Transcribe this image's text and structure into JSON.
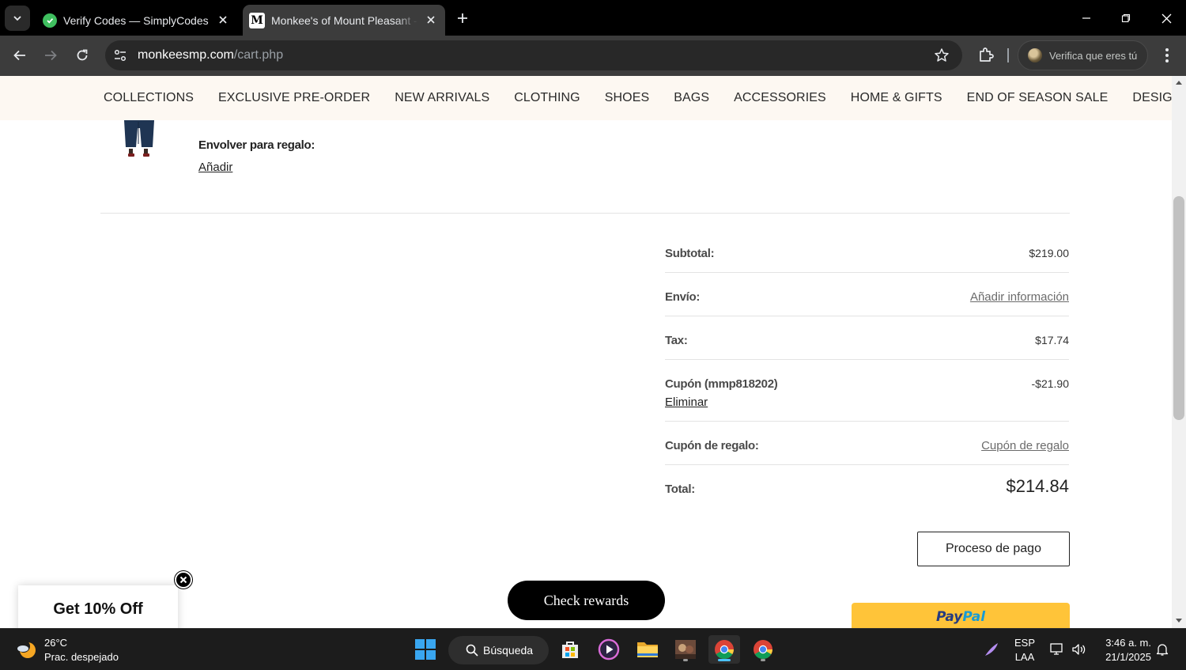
{
  "browser": {
    "tabs": [
      {
        "title": "Verify Codes — SimplyCodes",
        "active": false
      },
      {
        "title": "Monkee's of Mount Pleasant - S",
        "active": true
      }
    ],
    "url_host": "monkeesmp.com",
    "url_path": "/cart.php",
    "profile_label": "Verifica que eres tú"
  },
  "site": {
    "nav": [
      "COLLECTIONS",
      "EXCLUSIVE PRE-ORDER",
      "NEW ARRIVALS",
      "CLOTHING",
      "SHOES",
      "BAGS",
      "ACCESSORIES",
      "HOME & GIFTS",
      "END OF SEASON SALE",
      "DESIGNERS"
    ]
  },
  "cart": {
    "gift_wrap_label": "Envolver para regalo:",
    "gift_wrap_add": "Añadir",
    "summary": {
      "subtotal_label": "Subtotal:",
      "subtotal_value": "$219.00",
      "shipping_label": "Envío:",
      "shipping_link": "Añadir información",
      "tax_label": "Tax:",
      "tax_value": "$17.74",
      "coupon_label": "Cupón (mmp818202)",
      "coupon_value": "-$21.90",
      "coupon_remove": "Eliminar",
      "gift_coupon_label": "Cupón de regalo:",
      "gift_coupon_link": "Cupón de regalo",
      "total_label": "Total:",
      "total_value": "$214.84"
    },
    "checkout_button": "Proceso de pago",
    "paypal_part1": "Pay",
    "paypal_part2": "Pal"
  },
  "overlays": {
    "rewards_button": "Check rewards",
    "promo_text": "Get 10% Off"
  },
  "taskbar": {
    "weather_temp": "26°C",
    "weather_desc": "Prac. despejado",
    "search_label": "Búsqueda",
    "lang_top": "ESP",
    "lang_bottom": "LAA",
    "time": "3:46 a. m.",
    "date": "21/1/2025"
  },
  "colors": {
    "nav_bg": "#fdf8f2",
    "paypal_yellow": "#ffc439",
    "accent_blue": "#4cc2ff"
  }
}
